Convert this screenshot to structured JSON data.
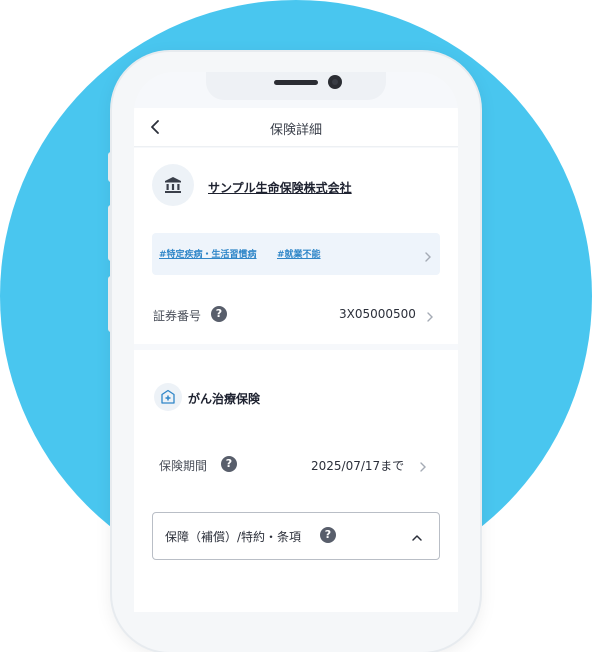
{
  "colors": {
    "background_circle": "#49c6ef",
    "tag_text": "#2f86c8",
    "tag_bg": "#eef4fb"
  },
  "header": {
    "title": "保険詳細",
    "back_icon": "chevron-left-icon"
  },
  "insurer": {
    "icon": "bank-icon",
    "name": "サンプル生命保険株式会社"
  },
  "tags": [
    "#特定疾病・生活習慣病",
    "#就業不能"
  ],
  "policy": {
    "label": "証券番号",
    "help": "?",
    "value": "3X05000500"
  },
  "product": {
    "icon": "medical-plus-icon",
    "title": "がん治療保険"
  },
  "period": {
    "label": "保険期間",
    "help": "?",
    "value": "2025/07/17まで"
  },
  "coverage": {
    "label": "保障（補償）/特約・条項",
    "help": "?",
    "expand_icon": "chevron-up-icon"
  }
}
